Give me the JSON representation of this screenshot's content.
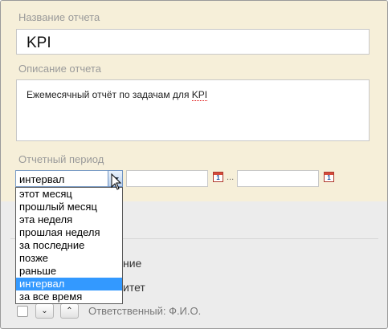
{
  "form": {
    "name_label": "Название отчета",
    "name_value": "KPI",
    "description_label": "Описание отчета",
    "description_value_prefix": "Ежемесячный отчёт по задачам для ",
    "description_value_kpi": "KPI",
    "period_label": "Отчетный период",
    "period_selected": "интервал",
    "date_separator": "...",
    "calendar_glyph": "1"
  },
  "dropdown": {
    "options": [
      "этот месяц",
      "прошлый месяц",
      "эта неделя",
      "прошлая неделя",
      "за последние",
      "позже",
      "раньше",
      "интервал",
      "за все время"
    ],
    "selected_index": 7
  },
  "background": {
    "partial_text_1": "ние",
    "partial_text_2": "итет",
    "responsible_label": "Ответственный: Ф.И.О.",
    "down_glyph": "⌄",
    "up_glyph": "⌃"
  },
  "colors": {
    "form_bg": "#f6efd9",
    "selected_option": "#3399ff"
  }
}
